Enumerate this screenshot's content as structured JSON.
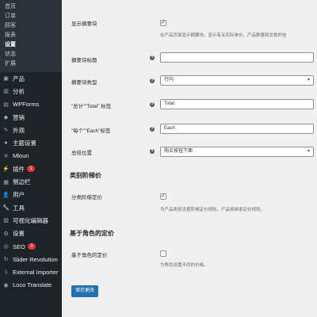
{
  "sidebar": {
    "submenu": [
      {
        "label": "首页",
        "current": false
      },
      {
        "label": "订单",
        "current": false
      },
      {
        "label": "顾客",
        "current": false
      },
      {
        "label": "报表",
        "current": false
      },
      {
        "label": "设置",
        "current": true
      },
      {
        "label": "状态",
        "current": false
      },
      {
        "label": "扩展",
        "current": false
      }
    ],
    "menu": [
      {
        "label": "产品",
        "icon": "box-icon",
        "glyph": "▣",
        "badge": ""
      },
      {
        "label": "分析",
        "icon": "analytics-icon",
        "glyph": "▥",
        "badge": ""
      },
      {
        "label": "WPForms",
        "icon": "forms-icon",
        "glyph": "▤",
        "badge": ""
      },
      {
        "label": "营销",
        "icon": "megaphone-icon",
        "glyph": "◆",
        "badge": ""
      },
      {
        "label": "外观",
        "icon": "brush-icon",
        "glyph": "✎",
        "badge": ""
      },
      {
        "label": "主题设置",
        "icon": "theme-settings-icon",
        "glyph": "●",
        "badge": ""
      },
      {
        "label": "Mloun",
        "icon": "mloun-icon",
        "glyph": "✕",
        "badge": ""
      },
      {
        "label": "插件",
        "icon": "plugin-icon",
        "glyph": "⚡",
        "badge": "1"
      },
      {
        "label": "侧边栏",
        "icon": "sidebar-icon",
        "glyph": "▦",
        "badge": ""
      },
      {
        "label": "用户",
        "icon": "users-icon",
        "glyph": "👤",
        "badge": ""
      },
      {
        "label": "工具",
        "icon": "wrench-icon",
        "glyph": "🔧",
        "badge": ""
      },
      {
        "label": "可视化编辑器",
        "icon": "visual-editor-icon",
        "glyph": "▧",
        "badge": ""
      },
      {
        "label": "设置",
        "icon": "settings-icon",
        "glyph": "⚙",
        "badge": ""
      },
      {
        "label": "SEO",
        "icon": "seo-icon",
        "glyph": "◎",
        "badge": "3"
      },
      {
        "label": "Slider Revolution",
        "icon": "slider-icon",
        "glyph": "↻",
        "badge": ""
      },
      {
        "label": "External Importer",
        "icon": "importer-icon",
        "glyph": "⇩",
        "badge": ""
      },
      {
        "label": "Loco Translate",
        "icon": "translate-icon",
        "glyph": "◉",
        "badge": ""
      }
    ]
  },
  "form": {
    "show_summary": {
      "label": "显示摘要块",
      "checked": true,
      "desc": "在产品页面显示摘要块。显示有关实际单价、产品数量和总数的信"
    },
    "summary_title": {
      "label": "摘要块标题",
      "value": ""
    },
    "summary_type": {
      "label": "摘要块类型",
      "value": "行内"
    },
    "total_label": {
      "label": "“总计”“Total” 标签",
      "value": "Total:"
    },
    "each_label": {
      "label": "“每个”“Each”标签",
      "value": "Each:"
    },
    "total_position": {
      "label": "总结位置",
      "value": "购买按钮下面"
    },
    "category_section": "类别阶梯价",
    "category_pricing": {
      "label": "分类阶梯定价",
      "checked": true,
      "desc": "为产品类别设置阶梯定价规则。产品将继承定价规则。"
    },
    "role_section": "基于角色的定价",
    "role_pricing": {
      "label": "基于角色的定价",
      "checked": false,
      "desc": "为角色设置不同的价格。"
    },
    "save_label": "保存更改"
  }
}
